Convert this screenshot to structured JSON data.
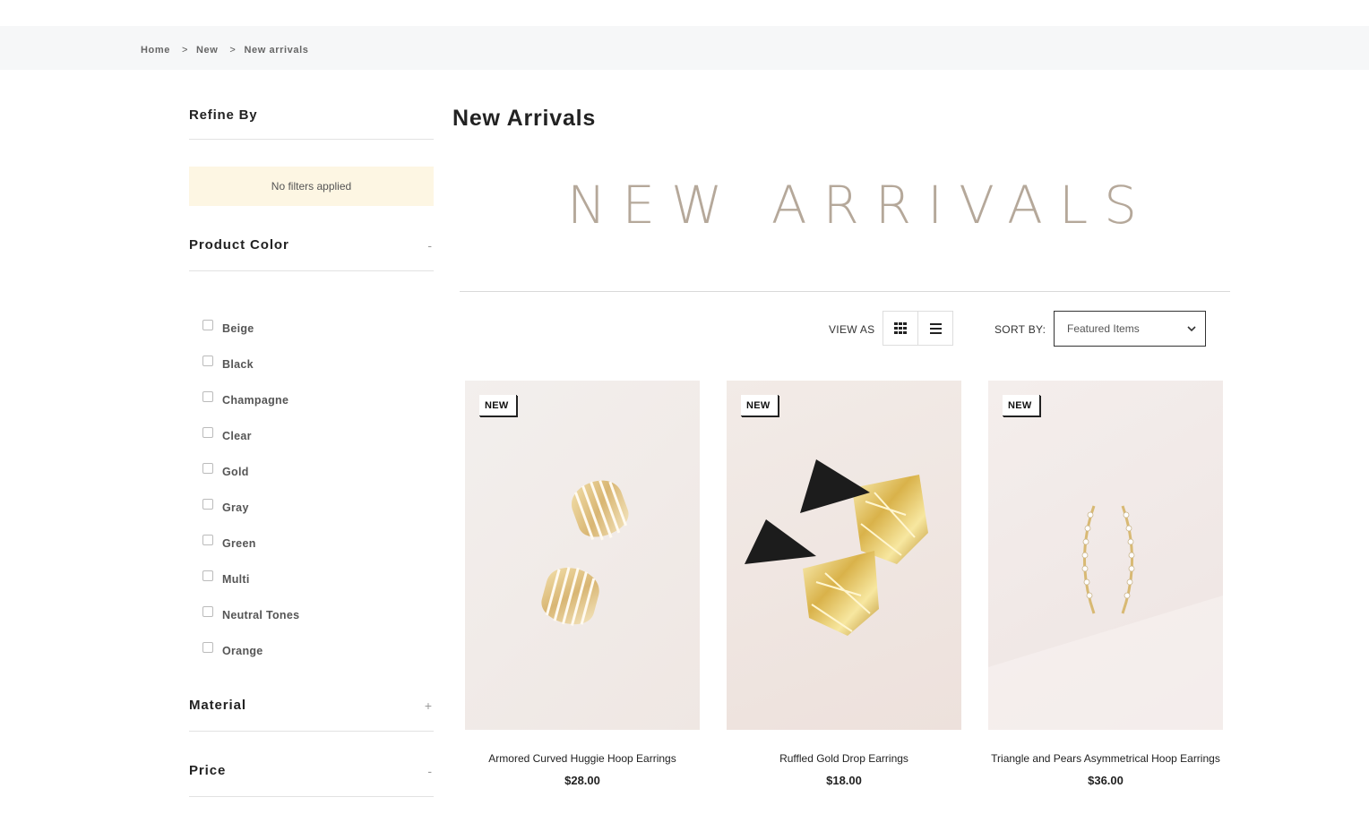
{
  "breadcrumb": [
    {
      "label": "Home"
    },
    {
      "label": "New"
    },
    {
      "label": "New arrivals"
    }
  ],
  "breadcrumb_separator": ">",
  "sidebar": {
    "title": "Refine By",
    "no_filters": "No filters applied",
    "product_color": {
      "title": "Product Color",
      "toggle": "-",
      "options": [
        "Beige",
        "Black",
        "Champagne",
        "Clear",
        "Gold",
        "Gray",
        "Green",
        "Multi",
        "Neutral Tones",
        "Orange"
      ]
    },
    "material": {
      "title": "Material",
      "toggle": "+"
    },
    "price": {
      "title": "Price",
      "toggle": "-"
    }
  },
  "main": {
    "title": "New Arrivals",
    "banner_text": "NEW ARRIVALS",
    "view_as_label": "VIEW AS",
    "sort_by_label": "SORT BY:",
    "sort_selected": "Featured Items"
  },
  "products": [
    {
      "badge": "NEW",
      "name": "Armored Curved Huggie Hoop Earrings",
      "price": "$28.00"
    },
    {
      "badge": "NEW",
      "name": "Ruffled Gold Drop Earrings",
      "price": "$18.00"
    },
    {
      "badge": "NEW",
      "name": "Triangle and Pears Asymmetrical Hoop Earrings",
      "price": "$36.00"
    }
  ],
  "colors": {
    "breadcrumb_bg": "#f6f7f8",
    "no_filter_bg": "#fdf6e3",
    "banner_text": "#b5a89a"
  }
}
